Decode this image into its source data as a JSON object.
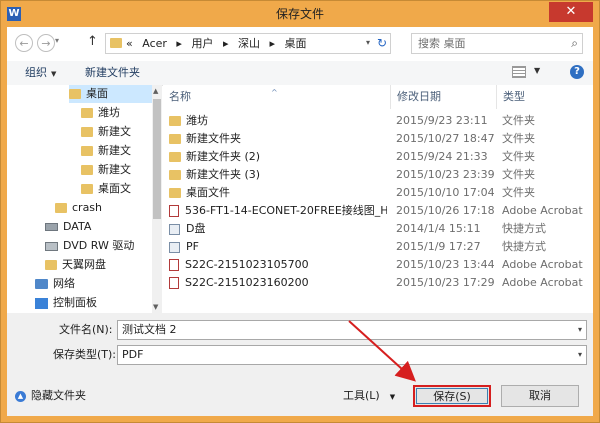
{
  "window": {
    "app_icon": "W",
    "title": "保存文件",
    "close_glyph": "✕"
  },
  "nav": {
    "back_glyph": "←",
    "forward_glyph": "→",
    "dropdown_glyph": "▾",
    "up_glyph": "↑",
    "refresh_glyph": "↻"
  },
  "address": {
    "prefix": "«",
    "segments": [
      "Acer",
      "▸",
      "用户",
      "▸",
      "深山",
      "▸",
      "桌面"
    ],
    "dropdown_glyph": "▾"
  },
  "search": {
    "placeholder": "搜索 桌面",
    "icon_glyph": "⌕"
  },
  "toolbar": {
    "organize": "组织",
    "organize_drop": "▼",
    "new_folder": "新建文件夹",
    "view_drop": "▼",
    "help_glyph": "?"
  },
  "sidebar": {
    "items": [
      {
        "label": "桌面",
        "icon": "folder-icon"
      },
      {
        "label": "潍坊",
        "icon": "folder-icon"
      },
      {
        "label": "新建文",
        "icon": "folder-icon"
      },
      {
        "label": "新建文",
        "icon": "folder-icon"
      },
      {
        "label": "新建文",
        "icon": "folder-icon"
      },
      {
        "label": "桌面文",
        "icon": "folder-icon"
      },
      {
        "label": "crash",
        "icon": "folder-icon"
      },
      {
        "label": "DATA",
        "icon": "drive-icon"
      },
      {
        "label": "DVD RW 驱动",
        "icon": "dvd-icon"
      },
      {
        "label": "天翼网盘",
        "icon": "cloud-icon"
      },
      {
        "label": "网络",
        "icon": "network-icon"
      },
      {
        "label": "控制面板",
        "icon": "control-panel-icon"
      }
    ]
  },
  "files": {
    "headers": {
      "name": "名称",
      "date": "修改日期",
      "type": "类型"
    },
    "sort_glyph": "^",
    "rows": [
      {
        "name": "潍坊",
        "date": "2015/9/23 23:11",
        "type": "文件夹",
        "icon": "folder-icon"
      },
      {
        "name": "新建文件夹",
        "date": "2015/10/27 18:47",
        "type": "文件夹",
        "icon": "folder-icon"
      },
      {
        "name": "新建文件夹 (2)",
        "date": "2015/9/24 21:33",
        "type": "文件夹",
        "icon": "folder-icon"
      },
      {
        "name": "新建文件夹 (3)",
        "date": "2015/10/23 23:39",
        "type": "文件夹",
        "icon": "folder-icon"
      },
      {
        "name": "桌面文件",
        "date": "2015/10/10 17:04",
        "type": "文件夹",
        "icon": "folder-icon"
      },
      {
        "name": "536-FT1-14-ECONET-20FREE接线图_H...",
        "date": "2015/10/26 17:18",
        "type": "Adobe Acrobat",
        "icon": "pdf-icon"
      },
      {
        "name": "D盘",
        "date": "2014/1/4 15:11",
        "type": "快捷方式",
        "icon": "shortcut-icon"
      },
      {
        "name": "PF",
        "date": "2015/1/9 17:27",
        "type": "快捷方式",
        "icon": "shortcut-icon"
      },
      {
        "name": "S22C-2151023105700",
        "date": "2015/10/23 13:44",
        "type": "Adobe Acrobat",
        "icon": "pdf-icon"
      },
      {
        "name": "S22C-2151023160200",
        "date": "2015/10/23 17:29",
        "type": "Adobe Acrobat",
        "icon": "pdf-icon"
      }
    ]
  },
  "form": {
    "filename_label": "文件名(N):",
    "filename_value": "测试文档 2",
    "filetype_label": "保存类型(T):",
    "filetype_value": "PDF",
    "dropdown_glyph": "▾"
  },
  "footer": {
    "hide_folders": "隐藏文件夹",
    "hide_glyph": "▲",
    "tools": "工具(L)",
    "tools_drop": "▼",
    "save": "保存(S)",
    "cancel": "取消"
  },
  "colors": {
    "title_bar": "#f0a94a",
    "close": "#c7392e",
    "highlight": "#d61f1f",
    "selected": "#cce8ff"
  }
}
